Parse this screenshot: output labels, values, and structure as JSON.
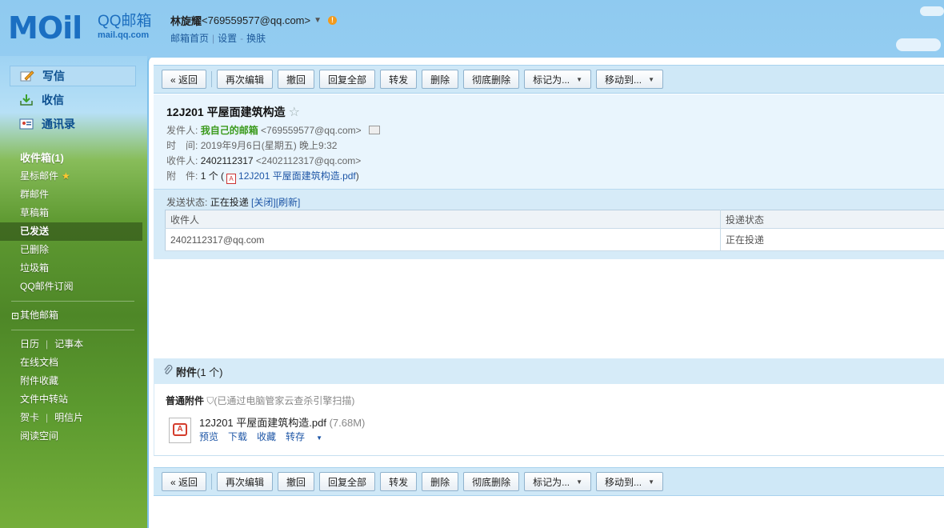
{
  "logo": {
    "main": "MOil",
    "cn": "QQ邮箱",
    "domain": "mail.qq.com"
  },
  "user": {
    "name": "林旋耀",
    "email": "<769559577@qq.com>",
    "links": [
      "邮箱首页",
      "设置",
      "换肤"
    ],
    "sep1": "|",
    "sep2": "-"
  },
  "sidebar": {
    "quick": [
      {
        "label": "写信",
        "icon": "pencil-icon"
      },
      {
        "label": "收信",
        "icon": "inbox-download-icon"
      },
      {
        "label": "通讯录",
        "icon": "contacts-card-icon"
      }
    ],
    "folders": [
      "收件箱(1)",
      "星标邮件",
      "群邮件",
      "草稿箱",
      "已发送",
      "已删除",
      "垃圾箱",
      "QQ邮件订阅"
    ],
    "other_mailbox": "其他邮箱",
    "tools": {
      "calendar": "日历",
      "notes": "记事本",
      "docs": "在线文档",
      "favorites": "附件收藏",
      "transfer": "文件中转站",
      "card": "贺卡",
      "postcard": "明信片",
      "reading": "阅读空间"
    }
  },
  "toolbar": {
    "back": "« 返回",
    "reedit": "再次编辑",
    "recall": "撤回",
    "reply_all": "回复全部",
    "forward": "转发",
    "delete": "删除",
    "purge": "彻底删除",
    "mark_as": "标记为...",
    "move_to": "移动到..."
  },
  "mail": {
    "subject": "12J201 平屋面建筑构造",
    "from_label": "发件人:",
    "from_name": "我自己的邮箱",
    "from_email": "<769559577@qq.com>",
    "time_label": "时　间:",
    "time_value": "2019年9月6日(星期五) 晚上9:32",
    "to_label": "收件人:",
    "to_name": "2402112317",
    "to_email": "<2402112317@qq.com>",
    "attach_label": "附　件:",
    "attach_count": "1 个 (",
    "attach_file": "12J201 平屋面建筑构造.pdf",
    "attach_close": ")"
  },
  "send_status": {
    "label": "发送状态:",
    "value": "正在投递",
    "close": "[关闭]",
    "refresh": "[刷新]",
    "col_recipient": "收件人",
    "col_status": "投递状态",
    "row_recipient": "2402112317@qq.com",
    "row_status": "正在投递"
  },
  "attachments": {
    "title": "附件",
    "count": "(1 个)",
    "section": "普通附件",
    "scan_note": "(已通过电脑管家云查杀引擎扫描)",
    "file_name": "12J201 平屋面建筑构造.pdf",
    "file_size": "(7.68M)",
    "actions": [
      "预览",
      "下载",
      "收藏",
      "转存"
    ]
  }
}
